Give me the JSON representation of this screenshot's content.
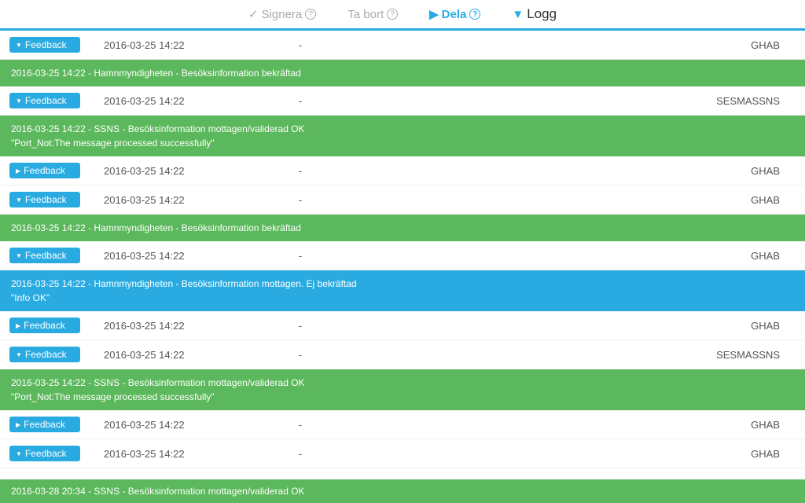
{
  "toolbar": {
    "items": [
      {
        "icon": "✓",
        "label": "Signera",
        "help": "?",
        "style": "normal"
      },
      {
        "icon": "",
        "label": "Ta bort",
        "help": "?",
        "style": "normal"
      },
      {
        "icon": "▶",
        "label": "Dela",
        "help": "?",
        "style": "highlight"
      },
      {
        "icon": "▼",
        "label": "Logg",
        "help": "",
        "style": "dropdown"
      }
    ]
  },
  "rows": [
    {
      "type": "main",
      "triangle": "▼",
      "label": "Feedback",
      "date": "2016-03-25 14:22",
      "dash": "-",
      "org": "GHAB"
    },
    {
      "type": "detail",
      "color": "green",
      "line1": "2016-03-25 14:22 - Hamnmyndigheten - Besöksinformation bekräftad",
      "line2": ""
    },
    {
      "type": "main",
      "triangle": "▼",
      "label": "Feedback",
      "date": "2016-03-25 14:22",
      "dash": "-",
      "org": "SESMASSNS"
    },
    {
      "type": "detail",
      "color": "green",
      "line1": "2016-03-25 14:22 - SSNS - Besöksinformation mottagen/validerad OK",
      "line2": "\"Port_Not:The message processed successfully\""
    },
    {
      "type": "main",
      "triangle": "▶",
      "label": "Feedback",
      "date": "2016-03-25 14:22",
      "dash": "-",
      "org": "GHAB"
    },
    {
      "type": "main",
      "triangle": "▼",
      "label": "Feedback",
      "date": "2016-03-25 14:22",
      "dash": "-",
      "org": "GHAB"
    },
    {
      "type": "detail",
      "color": "green",
      "line1": "2016-03-25 14:22 - Hamnmyndigheten - Besöksinformation bekräftad",
      "line2": ""
    },
    {
      "type": "main",
      "triangle": "▼",
      "label": "Feedback",
      "date": "2016-03-25 14:22",
      "dash": "-",
      "org": "GHAB"
    },
    {
      "type": "detail",
      "color": "blue",
      "line1": "2016-03-25 14:22 - Hamnmyndigheten - Besöksinformation mottagen. Ej bekräftad",
      "line2": "\"Info OK\""
    },
    {
      "type": "main",
      "triangle": "▶",
      "label": "Feedback",
      "date": "2016-03-25 14:22",
      "dash": "-",
      "org": "GHAB"
    },
    {
      "type": "main",
      "triangle": "▼",
      "label": "Feedback",
      "date": "2016-03-25 14:22",
      "dash": "-",
      "org": "SESMASSNS"
    },
    {
      "type": "detail",
      "color": "green",
      "line1": "2016-03-25 14:22 - SSNS - Besöksinformation mottagen/validerad OK",
      "line2": "\"Port_Not:The message processed successfully\""
    },
    {
      "type": "main",
      "triangle": "▶",
      "label": "Feedback",
      "date": "2016-03-25 14:22",
      "dash": "-",
      "org": "GHAB"
    },
    {
      "type": "main",
      "triangle": "▼",
      "label": "Feedback",
      "date": "2016-03-25 14:22",
      "dash": "-",
      "org": "GHAB"
    }
  ],
  "bottom_bar": {
    "text": "2016-03-28 20:34 - SSNS - Besöksinformation mottagen/validerad OK"
  }
}
